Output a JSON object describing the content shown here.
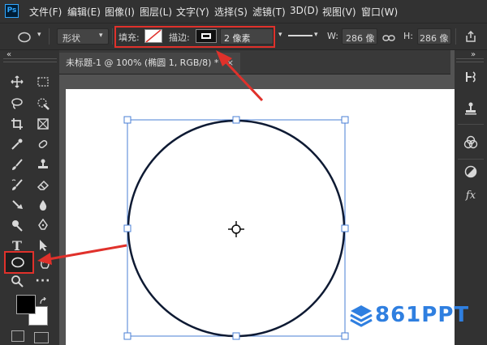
{
  "app": {
    "logo_text": "Ps"
  },
  "menu": [
    "文件(F)",
    "编辑(E)",
    "图像(I)",
    "图层(L)",
    "文字(Y)",
    "选择(S)",
    "滤镜(T)",
    "3D(D)",
    "视图(V)",
    "窗口(W)"
  ],
  "options": {
    "mode_value": "形状",
    "fill_label": "填充:",
    "stroke_label": "描边:",
    "stroke_width_value": "2 像素",
    "width_label": "W:",
    "width_value": "286 像",
    "height_label": "H:",
    "height_value": "286 像"
  },
  "document": {
    "tab_title": "未标题-1 @ 100% (椭圆 1, RGB/8) *",
    "close_glyph": "×"
  },
  "colors": {
    "annotation_red": "#e0312b",
    "selection_blue": "#4a7fd6",
    "watermark_blue": "#2f7fe0",
    "ui_dark": "#323232",
    "ui_mid": "#535353"
  },
  "watermark": {
    "text": "861PPT"
  }
}
